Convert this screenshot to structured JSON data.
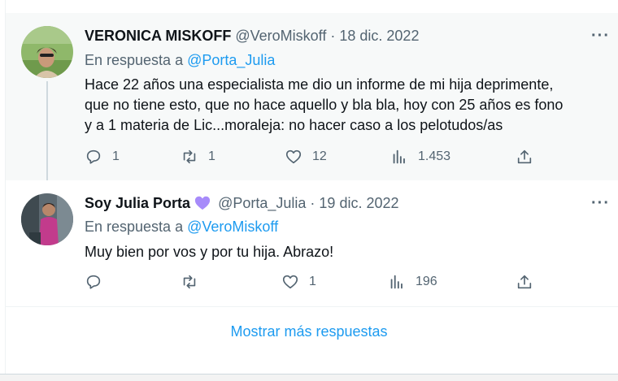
{
  "tweets": [
    {
      "name": "VERONICA MISKOFF",
      "handle": "@VeroMiskoff",
      "separator": "·",
      "date": "18 dic. 2022",
      "replying_prefix": "En respuesta a",
      "replying_to": "@Porta_Julia",
      "text_lines": [
        "Hace 22 años una especialista me dio un informe de mi hija  deprimente,",
        "que no tiene esto, que no hace aquello y bla bla, hoy con 25 años es fono",
        "y a 1 materia de Lic...moraleja: no hacer caso a los pelotudos/as"
      ],
      "more_icon": "more-horizontal-icon",
      "stats": {
        "replies": "1",
        "retweets": "1",
        "likes": "12",
        "views": "1.453"
      }
    },
    {
      "name": "Soy Julia Porta",
      "badge_icon": "purple-heart-icon",
      "handle": "@Porta_Julia",
      "separator": "·",
      "date": "19 dic. 2022",
      "replying_prefix": "En respuesta a",
      "replying_to": "@VeroMiskoff",
      "text_lines": [
        "Muy bien por vos y por tu hija. Abrazo!"
      ],
      "more_icon": "more-horizontal-icon",
      "stats": {
        "replies": "",
        "retweets": "",
        "likes": "1",
        "views": "196"
      }
    }
  ],
  "show_more_label": "Mostrar más respuestas",
  "colors": {
    "accent": "#1d9bf0",
    "muted": "#536471",
    "heart_badge": "#a78bfa"
  }
}
